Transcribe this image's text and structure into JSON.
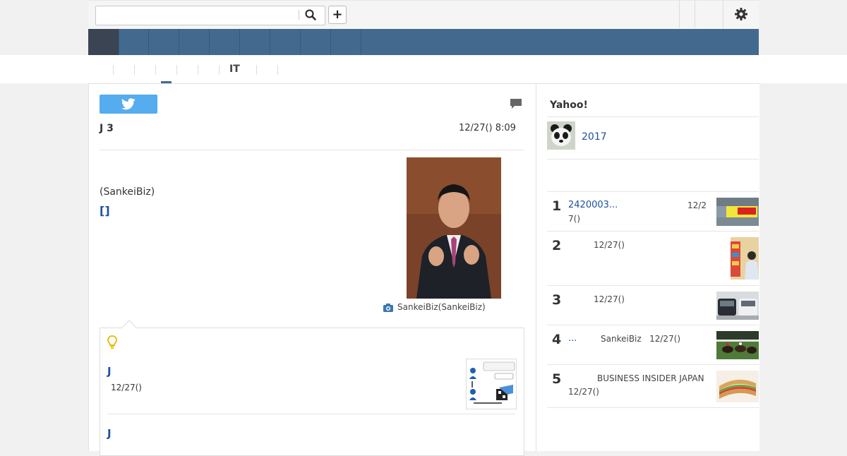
{
  "header": {
    "search_placeholder": "",
    "search_value": "",
    "plus_label": "+"
  },
  "subnav": {
    "active_label": "IT"
  },
  "article": {
    "author": "J 3",
    "timestamp": "12/27() 8:09",
    "source": "(SankeiBiz)",
    "bracket_link": "[]",
    "photo_caption": "SankeiBiz(SankeiBiz)"
  },
  "related": {
    "items": [
      {
        "title": "J",
        "date": "12/27()"
      },
      {
        "title": "J"
      }
    ]
  },
  "sidebar": {
    "heading": "Yahoo!",
    "feature_text": "2017",
    "ranking": [
      {
        "rank": "1",
        "title": "2420003...",
        "meta": "12/2",
        "meta2": "7()"
      },
      {
        "rank": "2",
        "title": "",
        "meta": "12/27()"
      },
      {
        "rank": "3",
        "title": "",
        "meta": "12/27()"
      },
      {
        "rank": "4",
        "title": "...",
        "meta": "SankeiBiz   12/27()"
      },
      {
        "rank": "5",
        "title": "",
        "meta": "BUSINESS INSIDER JAPAN",
        "meta2": "12/27()"
      }
    ]
  },
  "colors": {
    "nav": "#43698f",
    "nav_active": "#3b4453",
    "link": "#1e50a2",
    "twitter": "#55acee"
  }
}
